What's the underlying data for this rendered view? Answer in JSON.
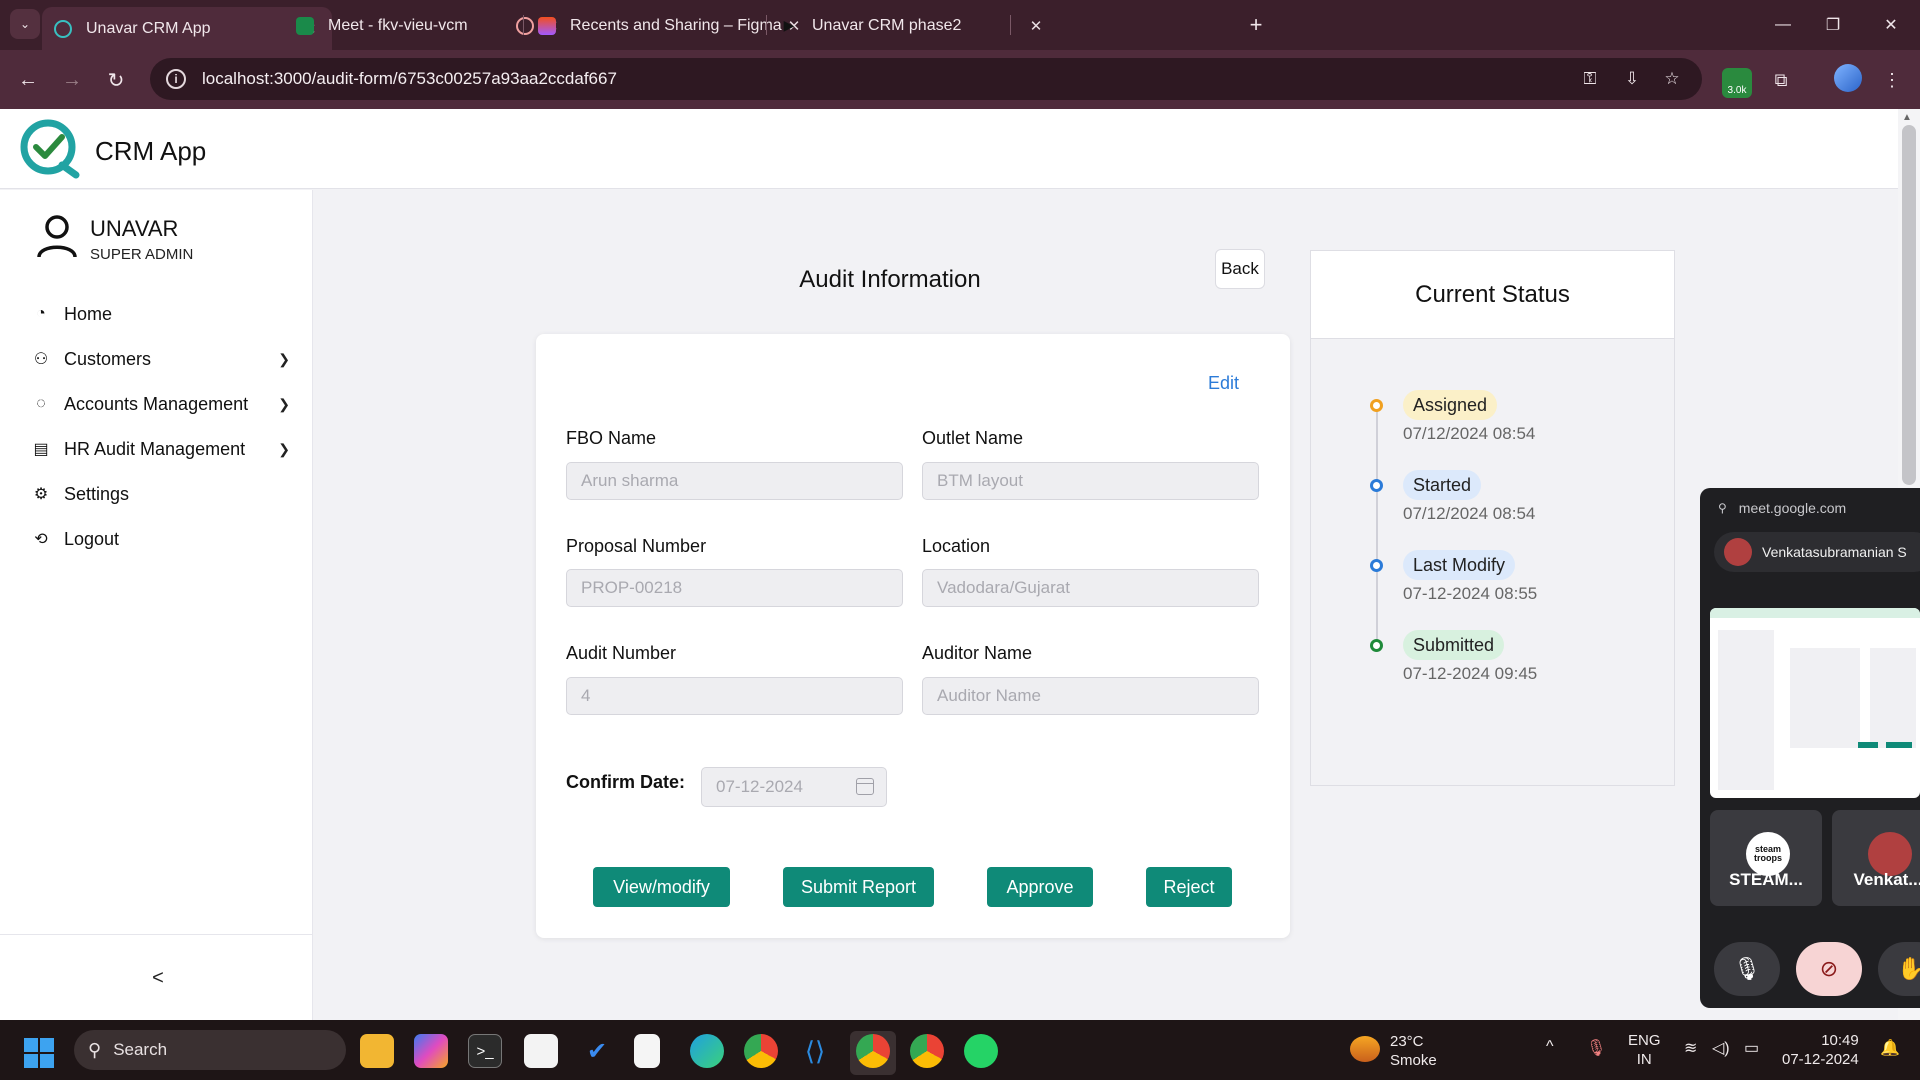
{
  "browser": {
    "tabs": [
      {
        "title": "Unavar CRM App",
        "active": true
      },
      {
        "title": "Meet - fkv-vieu-vcm",
        "active": false
      },
      {
        "title": "Recents and Sharing – Figma",
        "active": false
      },
      {
        "title": "Unavar CRM phase2",
        "active": false
      }
    ],
    "url": "localhost:3000/audit-form/6753c00257a93aa2ccdaf667",
    "extension_badge": "3.0k"
  },
  "app": {
    "brand": "CRM App",
    "accent_color": "#0f8a78"
  },
  "user": {
    "name": "UNAVAR",
    "role": "SUPER ADMIN"
  },
  "sidebar": {
    "items": [
      {
        "label": "Home",
        "icon": "dashboard-icon"
      },
      {
        "label": "Customers",
        "icon": "person-icon"
      },
      {
        "label": "Accounts Management",
        "icon": "chat-icon"
      },
      {
        "label": "HR Audit Management",
        "icon": "document-icon"
      },
      {
        "label": "Settings",
        "icon": "gear-icon"
      },
      {
        "label": "Logout",
        "icon": "logout-icon"
      }
    ],
    "collapse_label": "<"
  },
  "audit": {
    "title": "Audit Information",
    "back_label": "Back",
    "edit_label": "Edit",
    "fields": {
      "fbo_name": {
        "label": "FBO Name",
        "placeholder": "Arun sharma"
      },
      "outlet_name": {
        "label": "Outlet Name",
        "placeholder": "BTM layout"
      },
      "proposal_number": {
        "label": "Proposal Number",
        "placeholder": "PROP-00218"
      },
      "location": {
        "label": "Location",
        "placeholder": "Vadodara/Gujarat"
      },
      "audit_number": {
        "label": "Audit Number",
        "placeholder": "4"
      },
      "auditor_name": {
        "label": "Auditor Name",
        "placeholder": "Auditor Name"
      }
    },
    "confirm_date": {
      "label": "Confirm Date:",
      "value": "07-12-2024"
    },
    "buttons": {
      "view_modify": "View/modify",
      "submit_report": "Submit Report",
      "approve": "Approve",
      "reject": "Reject"
    }
  },
  "status": {
    "title": "Current Status",
    "timeline": [
      {
        "label": "Assigned",
        "date": "07/12/2024 08:54",
        "color": "#f0a020",
        "badge_bg": "#fbf0c8"
      },
      {
        "label": "Started",
        "date": "07/12/2024 08:54",
        "color": "#2b7bd8",
        "badge_bg": "#dce9fb"
      },
      {
        "label": "Last Modify",
        "date": "07-12-2024 08:55",
        "color": "#2b7bd8",
        "badge_bg": "#dce9fb"
      },
      {
        "label": "Submitted",
        "date": "07-12-2024 09:45",
        "color": "#1f8a3a",
        "badge_bg": "#d8f1df"
      }
    ]
  },
  "meet": {
    "url": "meet.google.com",
    "presenter": "Venkatasubramanian S",
    "tiles": [
      "STEAM...",
      "Venkat..."
    ],
    "tile_logo_text": "steam troops"
  },
  "taskbar": {
    "search_label": "Search",
    "weather_temp": "23°C",
    "weather_desc": "Smoke",
    "lang_top": "ENG",
    "lang_bottom": "IN",
    "time": "10:49",
    "date": "07-12-2024"
  }
}
